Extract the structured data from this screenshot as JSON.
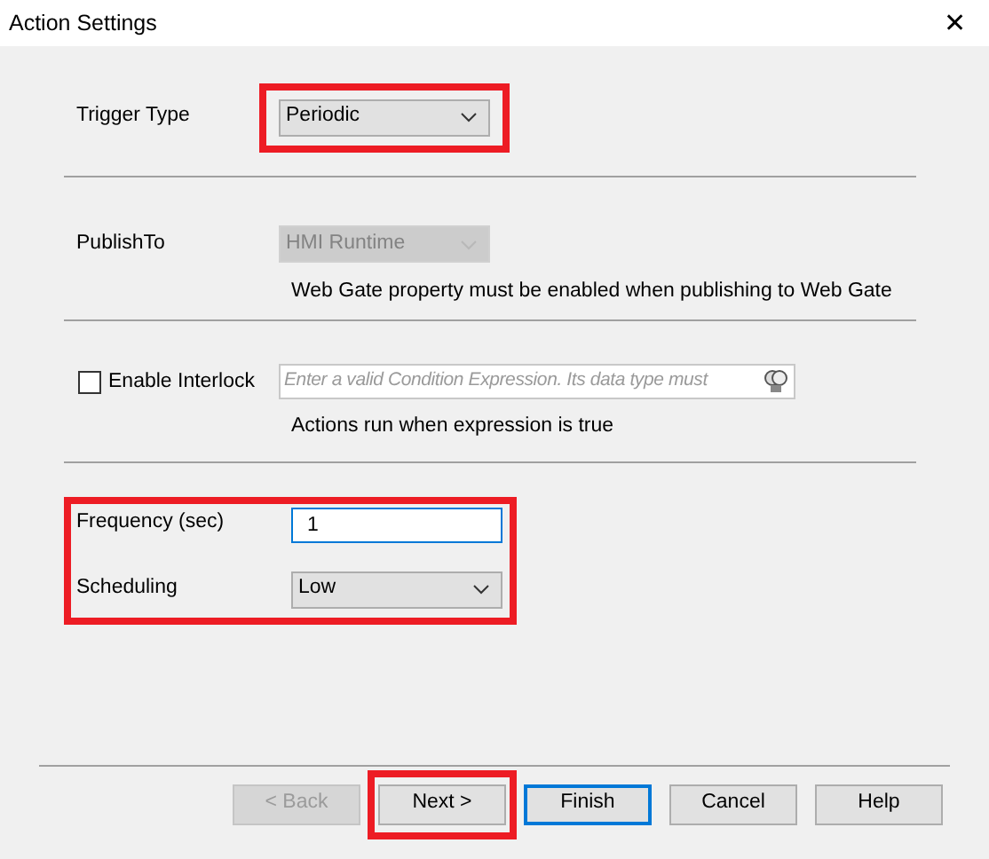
{
  "window": {
    "title": "Action Settings",
    "close": "✕"
  },
  "trigger_type": {
    "label": "Trigger Type",
    "value": "Periodic",
    "highlighted": true
  },
  "publish_to": {
    "label": "PublishTo",
    "value": "HMI Runtime",
    "disabled": true,
    "note": "Web Gate property must be enabled when publishing to Web Gate"
  },
  "interlock": {
    "label": "Enable Interlock",
    "checked": false,
    "placeholder": "Enter a valid Condition Expression. Its data type must",
    "note": "Actions run when expression is true"
  },
  "schedule": {
    "highlighted": true,
    "frequency_label": "Frequency (sec)",
    "frequency_value": "1",
    "scheduling_label": "Scheduling",
    "scheduling_value": "Low"
  },
  "buttons": [
    {
      "label": "< Back",
      "disabled": true,
      "default": false,
      "highlighted": false
    },
    {
      "label": "Next >",
      "disabled": false,
      "default": false,
      "highlighted": true
    },
    {
      "label": "Finish",
      "disabled": false,
      "default": true,
      "highlighted": false
    },
    {
      "label": "Cancel",
      "disabled": false,
      "default": false,
      "highlighted": false
    },
    {
      "label": "Help",
      "disabled": false,
      "default": false,
      "highlighted": false
    }
  ]
}
